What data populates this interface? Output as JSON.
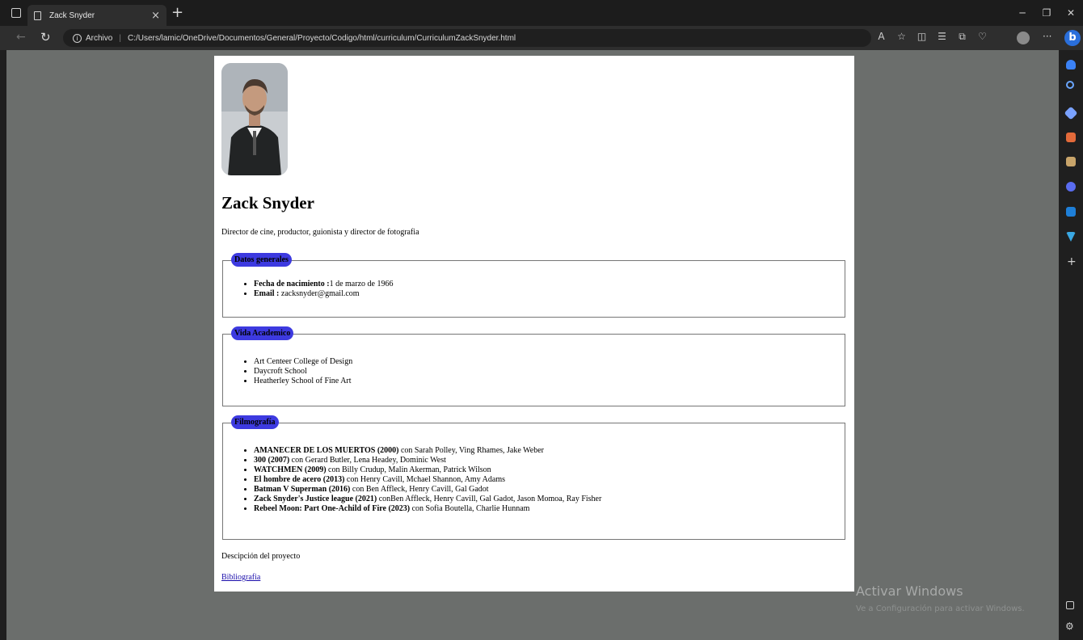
{
  "browser": {
    "tab_title": "Zack Snyder",
    "tab_close": "×",
    "new_tab": "+",
    "url_label": "Archivo",
    "url": "C:/Users/lamic/OneDrive/Documentos/General/Proyecto/Codigo/html/curriculum/CurriculumZackSnyder.html",
    "more": "···",
    "bing_letter": "b",
    "sidebar_add": "+"
  },
  "page": {
    "name": "Zack Snyder",
    "subtitle": "Director de cine, productor, guionista y director de fotografia",
    "sections": {
      "datos": {
        "legend": "Datos generales",
        "items": [
          {
            "label": "Fecha de nacimiento :",
            "value": "1 de marzo de 1966"
          },
          {
            "label": "Email :",
            "value": " zacksnyder@gmail.com"
          }
        ]
      },
      "academica": {
        "legend": "Vida Academico",
        "items": [
          "Art Centeer College of Design",
          "Daycroft School",
          "Heatherley School of Fine Art"
        ]
      },
      "filmografia": {
        "legend": "Filmografía",
        "items": [
          {
            "title": "AMANECER DE LOS MUERTOS (2000)",
            "cast": " con Sarah Polley, Ving Rhames, Jake Weber"
          },
          {
            "title": "300 (2007)",
            "cast": " con Gerard Butler, Lena Headey, Dominic West"
          },
          {
            "title": "WATCHMEN (2009)",
            "cast": " con Billy Crudup, Malin Akerman, Patrick Wilson"
          },
          {
            "title": "El hombre de acero (2013)",
            "cast": " con Henry Cavill, Mchael Shannon, Amy Adams"
          },
          {
            "title": "Batman V Superman (2016)",
            "cast": " con Ben Affleck, Henry Cavill, Gal Gadot"
          },
          {
            "title": "Zack Snyder's Justice league (2021)",
            "cast": " conBen Affleck, Henry Cavill, Gal Gadot, Jason Momoa, Ray Fisher"
          },
          {
            "title": "Rebeel Moon: Part One-Achild of Fire (2023)",
            "cast": " con Sofia Boutella, Charlie Hunnam"
          }
        ]
      }
    },
    "description": "Descipción del proyecto",
    "bibliography": "Bibliografia"
  },
  "watermark": {
    "title": "Activar Windows",
    "subtitle": "Ve a Configuración para activar Windows."
  },
  "colors": {
    "legend_bg": "#3d3ae0",
    "viewport_bg": "#6b6e6c",
    "link": "#1a0dab"
  }
}
